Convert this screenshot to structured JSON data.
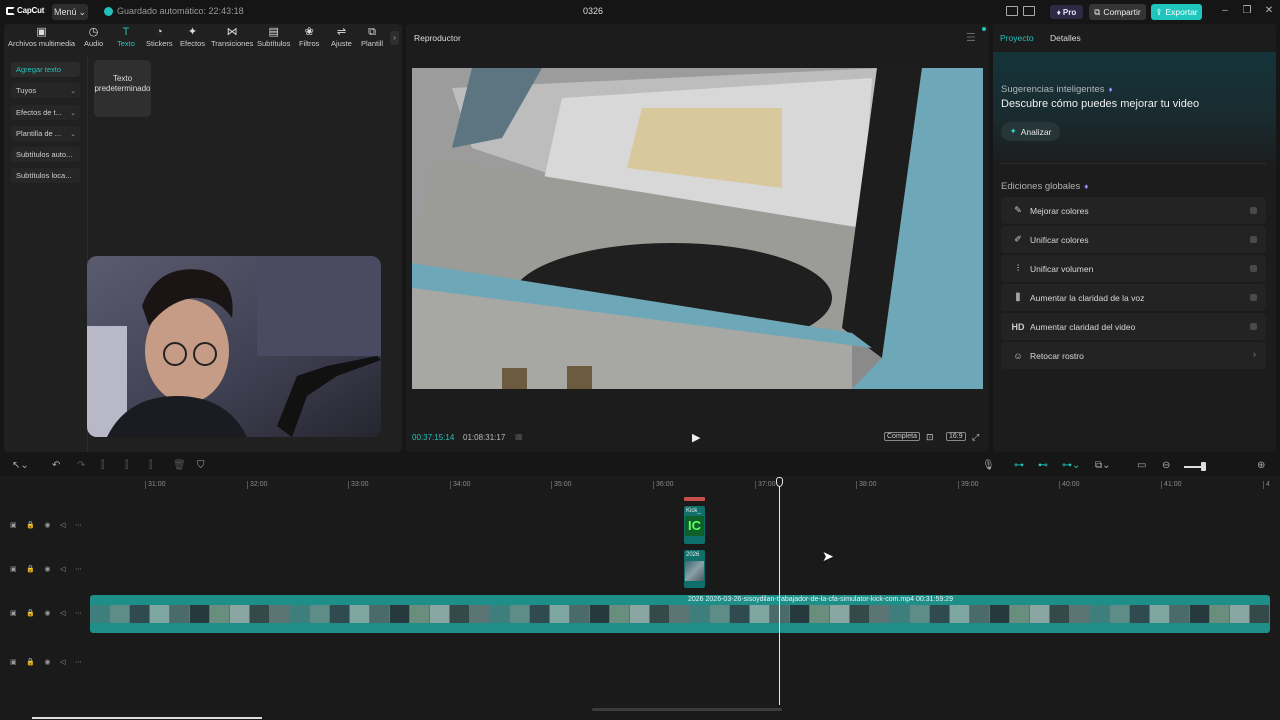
{
  "app": {
    "logo_text": "CapCut",
    "menu_label": "Menú",
    "autosave_text": "Guardado automático: 22:43:18",
    "project_title": "0326",
    "pro_label": "Pro",
    "share_label": "Compartir",
    "export_label": "Exportar",
    "accent_color": "#1fc6bd"
  },
  "toolbar": {
    "items": [
      {
        "label": "Archivos multimedia",
        "icon": "media-icon"
      },
      {
        "label": "Audio",
        "icon": "audio-icon"
      },
      {
        "label": "Texto",
        "icon": "text-icon",
        "active": true
      },
      {
        "label": "Stickers",
        "icon": "sticker-icon"
      },
      {
        "label": "Efectos",
        "icon": "effects-icon"
      },
      {
        "label": "Transiciones",
        "icon": "transition-icon"
      },
      {
        "label": "Subtítulos",
        "icon": "subtitles-icon"
      },
      {
        "label": "Filtros",
        "icon": "filters-icon"
      },
      {
        "label": "Ajuste",
        "icon": "adjust-icon"
      },
      {
        "label": "Plantill",
        "icon": "template-icon"
      }
    ]
  },
  "text_sidebar": {
    "items": [
      {
        "label": "Agregar texto",
        "active": true
      },
      {
        "label": "Tuyos",
        "dropdown": true
      },
      {
        "label": "Efectos de t...",
        "dropdown": true
      },
      {
        "label": "Plantilla de ...",
        "dropdown": true
      },
      {
        "label": "Subtítulos auto..."
      },
      {
        "label": "Subtítulos loca..."
      }
    ],
    "default_card": "Texto predeterminado"
  },
  "player": {
    "title": "Reproductor",
    "current_time": "00:37:15:14",
    "total_time": "01:08:31:17",
    "full_label": "Completa",
    "ratio_label": "16:9"
  },
  "right_panel": {
    "tabs": [
      "Proyecto",
      "Detalles"
    ],
    "suggestions_title": "Sugerencias inteligentes",
    "suggestions_heading": "Descubre cómo puedes mejorar tu video",
    "analyze_label": "Analizar",
    "global_title": "Ediciones globales",
    "features": [
      {
        "label": "Mejorar colores",
        "icon": "enhance-colors-icon"
      },
      {
        "label": "Unificar colores",
        "icon": "unify-colors-icon"
      },
      {
        "label": "Unificar volumen",
        "icon": "unify-volume-icon"
      },
      {
        "label": "Aumentar la claridad de la voz",
        "icon": "voice-clarity-icon"
      },
      {
        "label": "Aumentar claridad del video",
        "icon": "hd-icon"
      },
      {
        "label": "Retocar rostro",
        "icon": "face-retouch-icon"
      }
    ]
  },
  "timeline": {
    "ruler": [
      "31:00",
      "32:00",
      "33:00",
      "34:00",
      "35:00",
      "36:00",
      "37:00",
      "38:00",
      "39:00",
      "40:00",
      "41:00",
      "4"
    ],
    "main_clip_label": "2026   2026-03-26-sisoydilan-trabajador-de-la-cfa-simulator-kick-com.mp4   00:31:59:29",
    "clip_kick_label": "Kick_",
    "clip_2026_label": "2026"
  }
}
